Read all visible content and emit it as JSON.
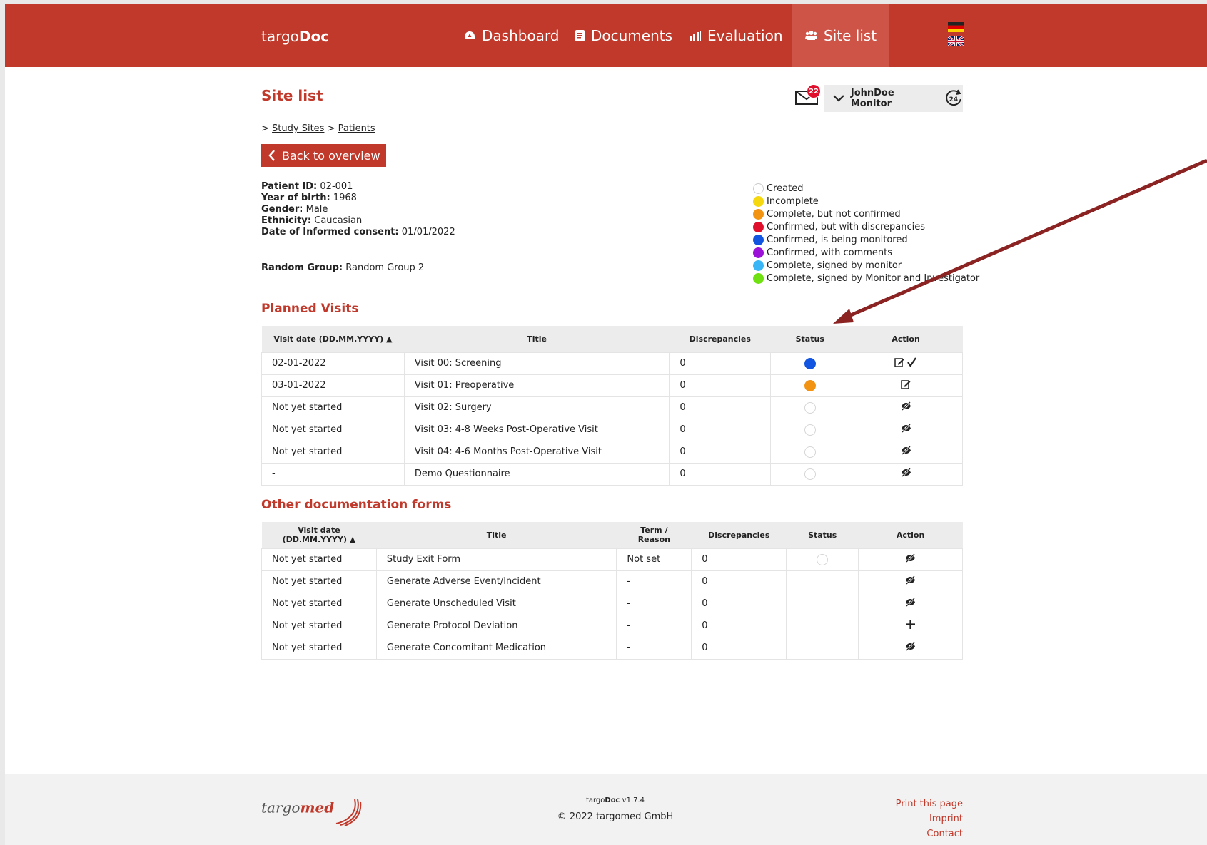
{
  "brand": {
    "prefix": "targo",
    "bold": "Doc"
  },
  "nav": [
    {
      "label": "Dashboard",
      "icon": "dashboard-icon"
    },
    {
      "label": "Documents",
      "icon": "documents-icon"
    },
    {
      "label": "Evaluation",
      "icon": "bar-chart-icon"
    },
    {
      "label": "Site list",
      "icon": "users-icon",
      "active": true
    }
  ],
  "header": {
    "title": "Site list",
    "breadcrumb": {
      "sep": ">",
      "items": [
        "Study Sites",
        "Patients"
      ]
    },
    "back_label": "Back to overview",
    "mail_count": "22",
    "user": "JohnDoe Monitor",
    "clock_label": "24"
  },
  "patient": {
    "id_label": "Patient ID:",
    "id": "02-001",
    "yob_label": "Year of birth:",
    "yob": "1968",
    "gender_label": "Gender:",
    "gender": "Male",
    "ethnicity_label": "Ethnicity:",
    "ethnicity": "Caucasian",
    "consent_label": "Date of Informed consent:",
    "consent": "01/01/2022",
    "random_label": "Random Group:",
    "random": "Random Group 2"
  },
  "legend": [
    {
      "label": "Created",
      "color": "#ffffff"
    },
    {
      "label": "Incomplete",
      "color": "#f5d80f"
    },
    {
      "label": "Complete, but not confirmed",
      "color": "#f39312"
    },
    {
      "label": "Confirmed, but with discrepancies",
      "color": "#e0102d"
    },
    {
      "label": "Confirmed, is being monitored",
      "color": "#1155e0"
    },
    {
      "label": "Confirmed, with comments",
      "color": "#9b11d8"
    },
    {
      "label": "Complete, signed by monitor",
      "color": "#3ab5f5"
    },
    {
      "label": "Complete, signed by Monitor and Investigator",
      "color": "#6fe011"
    }
  ],
  "planned": {
    "title": "Planned Visits",
    "headers": [
      "Visit date (DD.MM.YYYY) ▲",
      "Title",
      "Discrepancies",
      "Status",
      "Action"
    ],
    "rows": [
      {
        "date": "02-01-2022",
        "title": "Visit 00: Screening",
        "disc": "0",
        "status": "#1155e0",
        "action": "edit-check"
      },
      {
        "date": "03-01-2022",
        "title": "Visit 01: Preoperative",
        "disc": "0",
        "status": "#f39312",
        "action": "edit"
      },
      {
        "date": "Not yet started",
        "title": "Visit 02: Surgery",
        "disc": "0",
        "status": "",
        "action": "hidden"
      },
      {
        "date": "Not yet started",
        "title": "Visit 03: 4-8 Weeks Post-Operative Visit",
        "disc": "0",
        "status": "",
        "action": "hidden"
      },
      {
        "date": "Not yet started",
        "title": "Visit 04: 4-6 Months Post-Operative Visit",
        "disc": "0",
        "status": "",
        "action": "hidden"
      },
      {
        "date": "-",
        "title": "Demo Questionnaire",
        "disc": "0",
        "status": "",
        "action": "hidden"
      }
    ]
  },
  "other": {
    "title": "Other documentation forms",
    "headers": [
      "Visit date (DD.MM.YYYY) ▲",
      "Title",
      "Term / Reason",
      "Discrepancies",
      "Status",
      "Action"
    ],
    "rows": [
      {
        "date": "Not yet started",
        "title": "Study Exit Form",
        "term": "Not set",
        "disc": "0",
        "status": "empty",
        "action": "hidden"
      },
      {
        "date": "Not yet started",
        "title": "Generate Adverse Event/Incident",
        "term": "-",
        "disc": "0",
        "status": "none",
        "action": "hidden"
      },
      {
        "date": "Not yet started",
        "title": "Generate Unscheduled Visit",
        "term": "-",
        "disc": "0",
        "status": "none",
        "action": "hidden"
      },
      {
        "date": "Not yet started",
        "title": "Generate Protocol Deviation",
        "term": "-",
        "disc": "0",
        "status": "none",
        "action": "add"
      },
      {
        "date": "Not yet started",
        "title": "Generate Concomitant Medication",
        "term": "-",
        "disc": "0",
        "status": "none",
        "action": "hidden"
      }
    ]
  },
  "footer": {
    "logo_prefix": "targo",
    "logo_bold": "med",
    "version_prefix": "targo",
    "version_bold": "Doc",
    "version_suffix": " v1.7.4",
    "copyright": "© 2022 targomed GmbH",
    "links": [
      "Print this page",
      "Imprint",
      "Contact"
    ]
  },
  "colors": {
    "brand": "#c0392b",
    "arrow": "#8b2323"
  }
}
